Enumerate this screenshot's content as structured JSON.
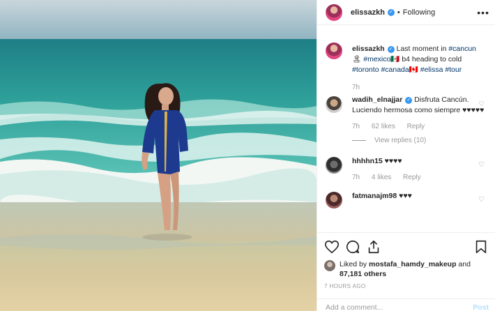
{
  "post": {
    "photo_alt": "woman in blue dress on beach",
    "author": "elissazkh",
    "follow_state": "Following",
    "more_glyph": "•••",
    "verified_glyph": "✓"
  },
  "caption": {
    "user": "elissazkh",
    "parts": [
      {
        "text": " Last moment in ",
        "tag": false
      },
      {
        "text": "#cancun",
        "tag": true
      },
      {
        "text": " 🏝 ",
        "tag": false
      },
      {
        "text": "#mexico🇲🇽",
        "tag": true
      },
      {
        "text": " b4 heading to cold ",
        "tag": false
      },
      {
        "text": "#toronto",
        "tag": true
      },
      {
        "text": " ",
        "tag": false
      },
      {
        "text": "#canada🇨🇦",
        "tag": true
      },
      {
        "text": " ",
        "tag": false
      },
      {
        "text": "#elissa",
        "tag": true
      },
      {
        "text": " ",
        "tag": false
      },
      {
        "text": "#tour",
        "tag": true
      }
    ],
    "time": "7h"
  },
  "comments": [
    {
      "user": "wadih_elnajjar",
      "verified": true,
      "text": "Disfruta Cancún. Luciendo hermosa como siempre ♥♥♥♥♥",
      "time": "7h",
      "likes": "62 likes",
      "reply": "Reply",
      "view_replies": "View replies (10)"
    },
    {
      "user": "hhhhn15",
      "verified": false,
      "text": "♥♥♥♥",
      "time": "7h",
      "likes": "4 likes",
      "reply": "Reply"
    },
    {
      "user": "fatmanajm98",
      "verified": false,
      "text": "♥♥♥",
      "time": "",
      "likes": "",
      "reply": ""
    }
  ],
  "likes": {
    "prefix": "Liked by",
    "user": "mostafa_hamdy_makeup",
    "and": "and",
    "count": "87,181 others"
  },
  "timestamp": "7 HOURS AGO",
  "add_comment": {
    "placeholder": "Add a comment...",
    "post": "Post"
  },
  "icons": [
    "heart-icon",
    "comment-icon",
    "share-icon",
    "bookmark-icon",
    "small-heart-icon"
  ],
  "colors": {
    "link": "#003569",
    "verified": "#3897f0",
    "muted": "#999999",
    "post_disabled": "#b2dffc"
  }
}
